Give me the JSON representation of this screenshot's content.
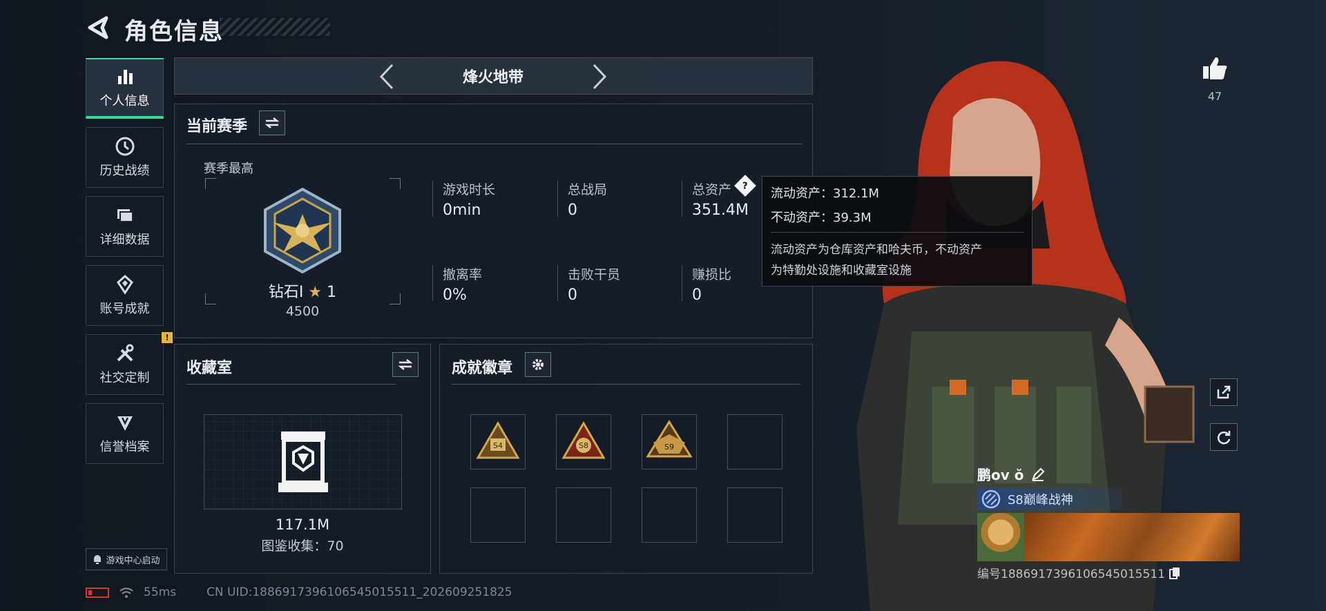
{
  "header": {
    "title": "角色信息"
  },
  "sidebar": {
    "items": [
      {
        "label": "个人信息",
        "icon": "bar-chart-icon"
      },
      {
        "label": "历史战绩",
        "icon": "clock-icon"
      },
      {
        "label": "详细数据",
        "icon": "folder-icon"
      },
      {
        "label": "账号成就",
        "icon": "achievement-icon"
      },
      {
        "label": "社交定制",
        "icon": "tools-icon"
      },
      {
        "label": "信誉档案",
        "icon": "shield-icon"
      }
    ],
    "launch_label": "游戏中心启动"
  },
  "mode": {
    "title": "烽火地带"
  },
  "season": {
    "title": "当前赛季",
    "best_label": "赛季最高",
    "rank": "钻石Ⅰ",
    "stars": "1",
    "points": "4500",
    "stats": [
      {
        "label": "游戏时长",
        "value": "0min"
      },
      {
        "label": "总战局",
        "value": "0"
      },
      {
        "label": "总资产",
        "value": "351.4M"
      },
      {
        "label": "撤离率",
        "value": "0%"
      },
      {
        "label": "击败干员",
        "value": "0"
      },
      {
        "label": "赚损比",
        "value": "0"
      }
    ]
  },
  "tooltip": {
    "liquid": "流动资产：312.1M",
    "fixed": "不动资产：39.3M",
    "desc_line1": "流动资产为仓库资产和哈夫币，不动资产",
    "desc_line2": "为特勤处设施和收藏室设施"
  },
  "collection": {
    "title": "收藏室",
    "value": "117.1M",
    "count_text": "图鉴收集：70"
  },
  "achievements": {
    "title": "成就徽章",
    "badges": [
      "S4",
      "S8",
      "S9"
    ]
  },
  "social": {
    "likes": "47"
  },
  "player": {
    "name": "鹏ov ŏ",
    "title": "S8巅峰战神",
    "id_text": "编号1886917396106545015511"
  },
  "status": {
    "ping": "55ms",
    "uid": "CN UID:1886917396106545015511_202609251825"
  },
  "colors": {
    "accent": "#3ed69a",
    "warning": "#e7b82c",
    "battery_low": "#d23a3a"
  }
}
